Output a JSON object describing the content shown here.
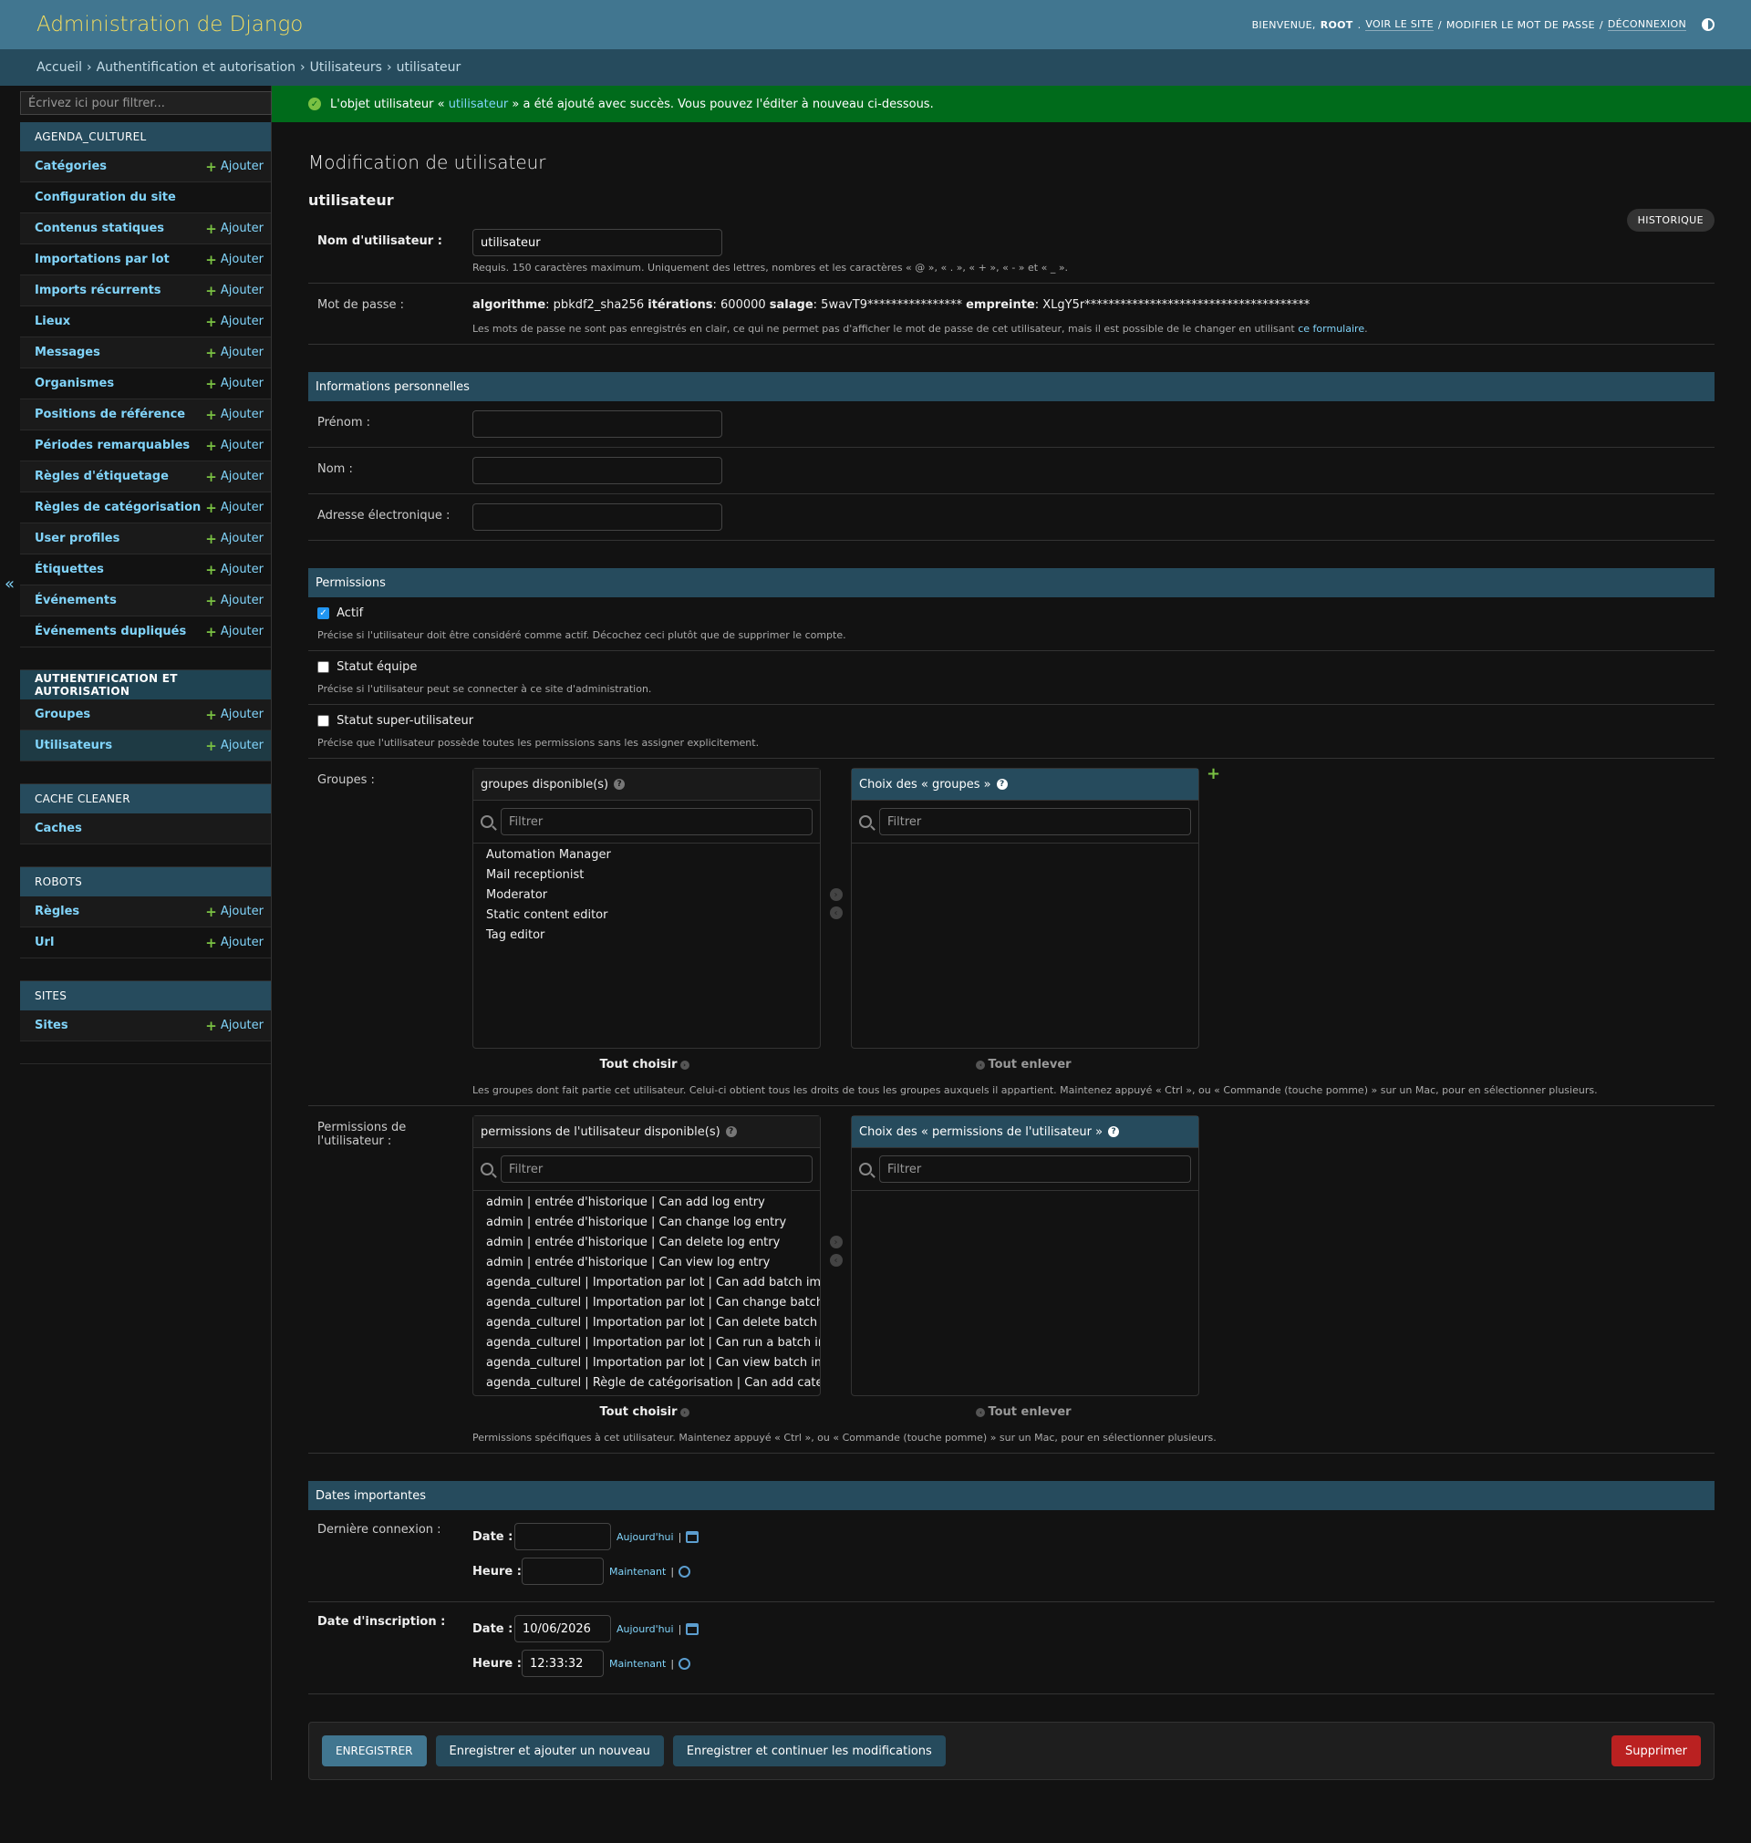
{
  "header": {
    "branding": "Administration de Django",
    "welcome": "Bienvenue,",
    "user": "root",
    "view_site": "Voir le site",
    "change_password": "Modifier le mot de passe",
    "logout": "Déconnexion"
  },
  "breadcrumbs": [
    "Accueil",
    "Authentification et autorisation",
    "Utilisateurs",
    "utilisateur"
  ],
  "sidebar": {
    "filter_placeholder": "Écrivez ici pour filtrer...",
    "add_label": "Ajouter",
    "apps": [
      {
        "name": "AGENDA_CULTUREL",
        "models": [
          {
            "name": "Catégories",
            "add": true
          },
          {
            "name": "Configuration du site",
            "add": false
          },
          {
            "name": "Contenus statiques",
            "add": true
          },
          {
            "name": "Importations par lot",
            "add": true
          },
          {
            "name": "Imports récurrents",
            "add": true
          },
          {
            "name": "Lieux",
            "add": true
          },
          {
            "name": "Messages",
            "add": true
          },
          {
            "name": "Organismes",
            "add": true
          },
          {
            "name": "Positions de référence",
            "add": true
          },
          {
            "name": "Périodes remarquables",
            "add": true
          },
          {
            "name": "Règles d'étiquetage",
            "add": true
          },
          {
            "name": "Règles de catégorisation",
            "add": true
          },
          {
            "name": "User profiles",
            "add": true
          },
          {
            "name": "Étiquettes",
            "add": true
          },
          {
            "name": "Événements",
            "add": true
          },
          {
            "name": "Événements dupliqués",
            "add": true
          }
        ]
      },
      {
        "name": "AUTHENTIFICATION ET AUTORISATION",
        "current": true,
        "models": [
          {
            "name": "Groupes",
            "add": true
          },
          {
            "name": "Utilisateurs",
            "add": true,
            "selected": true
          }
        ]
      },
      {
        "name": "CACHE CLEANER",
        "models": [
          {
            "name": "Caches",
            "add": false
          }
        ]
      },
      {
        "name": "ROBOTS",
        "models": [
          {
            "name": "Règles",
            "add": true
          },
          {
            "name": "Url",
            "add": true
          }
        ]
      },
      {
        "name": "SITES",
        "models": [
          {
            "name": "Sites",
            "add": true
          }
        ]
      }
    ]
  },
  "message": {
    "prefix": "L'objet utilisateur «",
    "link": "utilisateur",
    "suffix": "» a été ajouté avec succès. Vous pouvez l'éditer à nouveau ci-dessous."
  },
  "page": {
    "title": "Modification de utilisateur",
    "object_name": "utilisateur",
    "history": "HISTORIQUE"
  },
  "form": {
    "username_label": "Nom d'utilisateur :",
    "username_value": "utilisateur",
    "username_help": "Requis. 150 caractères maximum. Uniquement des lettres, nombres et les caractères « @ », « . », « + », « - » et « _ ».",
    "password_label": "Mot de passe :",
    "pw_algo_key": "algorithme",
    "pw_algo_val": ": pbkdf2_sha256",
    "pw_iter_key": "itérations",
    "pw_iter_val": ": 600000",
    "pw_salt_key": "salage",
    "pw_salt_val": ": 5wavT9****************",
    "pw_hash_key": "empreinte",
    "pw_hash_val": ": XLgY5r**************************************",
    "password_help_prefix": "Les mots de passe ne sont pas enregistrés en clair, ce qui ne permet pas d'afficher le mot de passe de cet utilisateur, mais il est possible de le changer en utilisant",
    "password_help_link": "ce formulaire",
    "password_help_suffix": ".",
    "personal_caption": "Informations personnelles",
    "first_name_label": "Prénom :",
    "last_name_label": "Nom :",
    "email_label": "Adresse électronique :",
    "permissions_caption": "Permissions",
    "active_label": "Actif",
    "active_help": "Précise si l'utilisateur doit être considéré comme actif. Décochez ceci plutôt que de supprimer le compte.",
    "staff_label": "Statut équipe",
    "staff_help": "Précise si l'utilisateur peut se connecter à ce site d'administration.",
    "superuser_label": "Statut super-utilisateur",
    "superuser_help": "Précise que l'utilisateur possède toutes les permissions sans les assigner explicitement.",
    "groups_label": "Groupes :",
    "groups_available_title": "groupes disponible(s)",
    "groups_chosen_title": "Choix des « groupes »",
    "filter_placeholder": "Filtrer",
    "groups_available": [
      "Automation Manager",
      "Mail receptionist",
      "Moderator",
      "Static content editor",
      "Tag editor"
    ],
    "choose_all": "Tout choisir",
    "remove_all": "Tout enlever",
    "groups_help": "Les groupes dont fait partie cet utilisateur. Celui-ci obtient tous les droits de tous les groupes auxquels il appartient. Maintenez appuyé « Ctrl », ou « Commande (touche pomme) » sur un Mac, pour en sélectionner plusieurs.",
    "perms_label_1": "Permissions de",
    "perms_label_2": "l'utilisateur :",
    "perms_available_title": "permissions de l'utilisateur disponible(s)",
    "perms_chosen_title": "Choix des « permissions de l'utilisateur »",
    "perms_available": [
      "admin | entrée d'historique | Can add log entry",
      "admin | entrée d'historique | Can change log entry",
      "admin | entrée d'historique | Can delete log entry",
      "admin | entrée d'historique | Can view log entry",
      "agenda_culturel | Importation par lot | Can add batch impo",
      "agenda_culturel | Importation par lot | Can change batch in",
      "agenda_culturel | Importation par lot | Can delete batch im",
      "agenda_culturel | Importation par lot | Can run a batch imp",
      "agenda_culturel | Importation par lot | Can view batch impo",
      "agenda_culturel | Règle de catégorisation | Can add catego"
    ],
    "perms_help": "Permissions spécifiques à cet utilisateur. Maintenez appuyé « Ctrl », ou « Commande (touche pomme) » sur un Mac, pour en sélectionner plusieurs.",
    "dates_caption": "Dates importantes",
    "last_login_label": "Dernière connexion :",
    "date_joined_label": "Date d'inscription :",
    "date_label": "Date :",
    "time_label": "Heure :",
    "today": "Aujourd'hui",
    "now": "Maintenant",
    "last_login_date": "",
    "last_login_time": "",
    "joined_date": "10/06/2026",
    "joined_time": "12:33:32"
  },
  "buttons": {
    "save": "Enregistrer",
    "save_add": "Enregistrer et ajouter un nouveau",
    "save_continue": "Enregistrer et continuer les modifications",
    "delete": "Supprimer"
  },
  "colors": {
    "header_bg": "#417690",
    "branding": "#f5dd5d",
    "breadcrumbs_bg": "#264b5d",
    "success_bg": "#006b1b",
    "danger": "#ba2121"
  }
}
